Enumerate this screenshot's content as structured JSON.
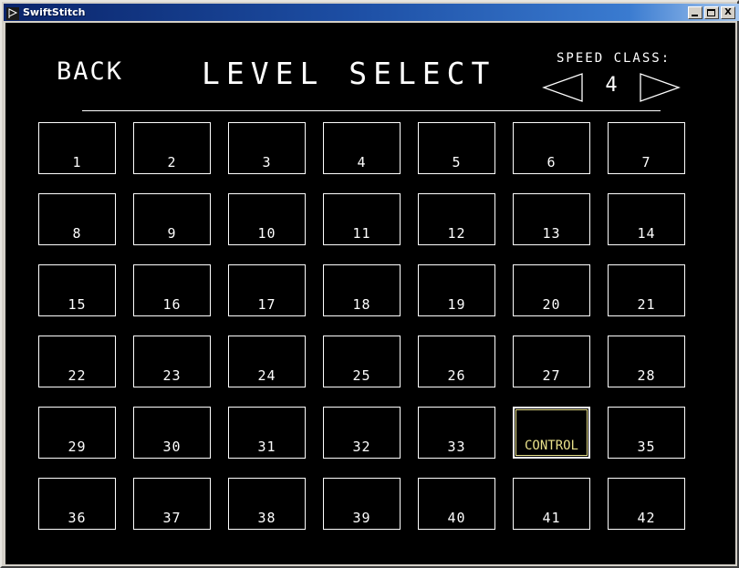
{
  "window": {
    "title": "SwiftStitch",
    "icon": "app-icon",
    "buttons": {
      "minimize": "minimize",
      "maximize": "maximize",
      "close": "X"
    }
  },
  "header": {
    "back_label": "BACK",
    "screen_title": "LEVEL SELECT",
    "speed_class_label": "SPEED CLASS:",
    "speed_class_value": "4",
    "prev_arrow": "left-triangle-icon",
    "next_arrow": "right-triangle-icon"
  },
  "colors": {
    "background": "#000000",
    "stroke": "#ffffff",
    "selected": "#e8e08a",
    "titlebar_start": "#0a246a",
    "titlebar_end": "#a6c8f0",
    "chrome": "#d4d0c8"
  },
  "grid": {
    "columns": 7,
    "rows": 6,
    "cells": [
      {
        "label": "1",
        "selected": false
      },
      {
        "label": "2",
        "selected": false
      },
      {
        "label": "3",
        "selected": false
      },
      {
        "label": "4",
        "selected": false
      },
      {
        "label": "5",
        "selected": false
      },
      {
        "label": "6",
        "selected": false
      },
      {
        "label": "7",
        "selected": false
      },
      {
        "label": "8",
        "selected": false
      },
      {
        "label": "9",
        "selected": false
      },
      {
        "label": "10",
        "selected": false
      },
      {
        "label": "11",
        "selected": false
      },
      {
        "label": "12",
        "selected": false
      },
      {
        "label": "13",
        "selected": false
      },
      {
        "label": "14",
        "selected": false
      },
      {
        "label": "15",
        "selected": false
      },
      {
        "label": "16",
        "selected": false
      },
      {
        "label": "17",
        "selected": false
      },
      {
        "label": "18",
        "selected": false
      },
      {
        "label": "19",
        "selected": false
      },
      {
        "label": "20",
        "selected": false
      },
      {
        "label": "21",
        "selected": false
      },
      {
        "label": "22",
        "selected": false
      },
      {
        "label": "23",
        "selected": false
      },
      {
        "label": "24",
        "selected": false
      },
      {
        "label": "25",
        "selected": false
      },
      {
        "label": "26",
        "selected": false
      },
      {
        "label": "27",
        "selected": false
      },
      {
        "label": "28",
        "selected": false
      },
      {
        "label": "29",
        "selected": false
      },
      {
        "label": "30",
        "selected": false
      },
      {
        "label": "31",
        "selected": false
      },
      {
        "label": "32",
        "selected": false
      },
      {
        "label": "33",
        "selected": false
      },
      {
        "label": "CONTROL",
        "selected": true
      },
      {
        "label": "35",
        "selected": false
      },
      {
        "label": "36",
        "selected": false
      },
      {
        "label": "37",
        "selected": false
      },
      {
        "label": "38",
        "selected": false
      },
      {
        "label": "39",
        "selected": false
      },
      {
        "label": "40",
        "selected": false
      },
      {
        "label": "41",
        "selected": false
      },
      {
        "label": "42",
        "selected": false
      }
    ]
  }
}
